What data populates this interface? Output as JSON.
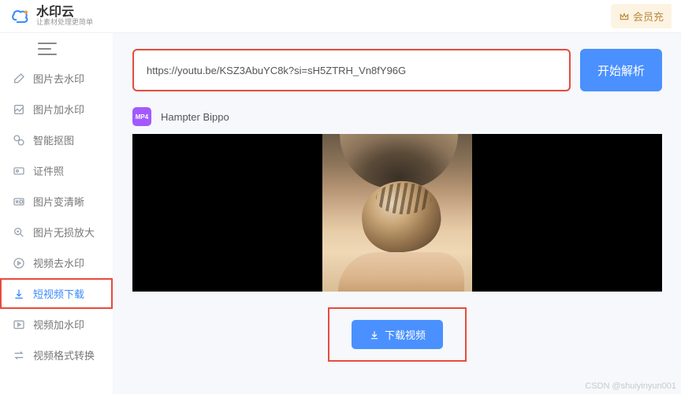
{
  "header": {
    "brand_title": "水印云",
    "brand_sub": "让素材处理更简单",
    "member_label": "会员充"
  },
  "sidebar": {
    "items": [
      {
        "label": "图片去水印",
        "icon": "eraser-icon"
      },
      {
        "label": "图片加水印",
        "icon": "stamp-icon"
      },
      {
        "label": "智能抠图",
        "icon": "cutout-icon"
      },
      {
        "label": "证件照",
        "icon": "idcard-icon"
      },
      {
        "label": "图片变清晰",
        "icon": "hd-icon"
      },
      {
        "label": "图片无损放大",
        "icon": "enlarge-icon"
      },
      {
        "label": "视频去水印",
        "icon": "play-erase-icon"
      },
      {
        "label": "短视频下载",
        "icon": "download-icon"
      },
      {
        "label": "视频加水印",
        "icon": "play-stamp-icon"
      },
      {
        "label": "视频格式转换",
        "icon": "convert-icon"
      }
    ],
    "active_index": 7
  },
  "main": {
    "url_value": "https://youtu.be/KSZ3AbuYC8k?si=sH5ZTRH_Vn8fY96G",
    "parse_label": "开始解析",
    "result": {
      "badge": "MP4",
      "title": "Hampter Bippo"
    },
    "download_label": "下载视频"
  },
  "watermark": "CSDN @shuiyinyun001"
}
